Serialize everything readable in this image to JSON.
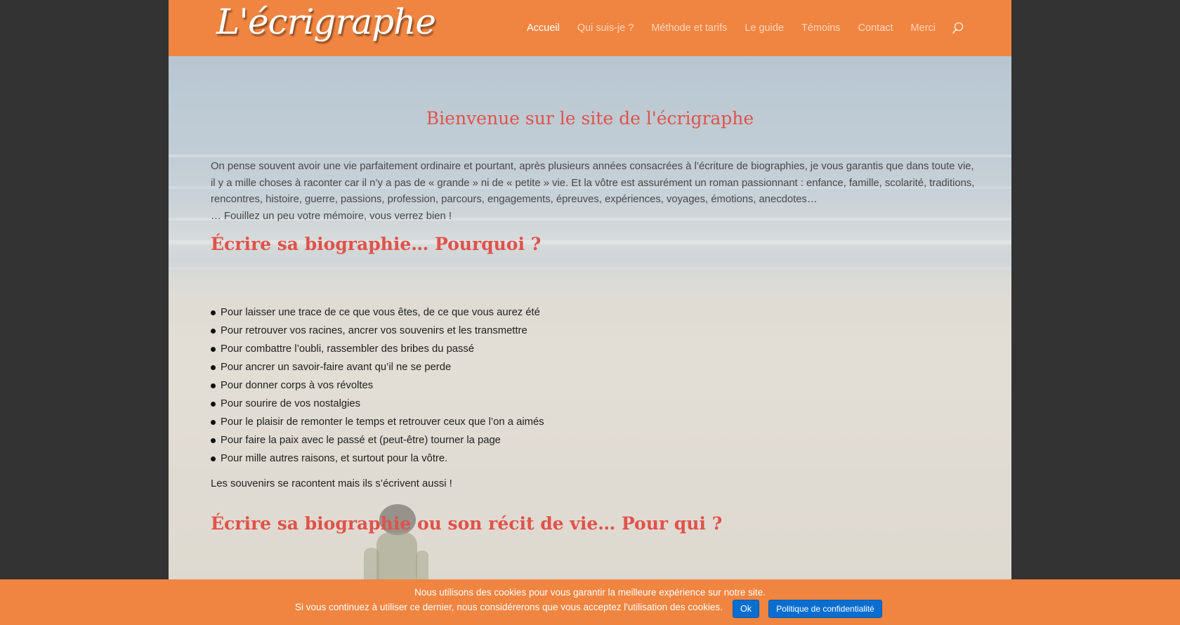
{
  "header": {
    "logo_text": "L'écrigraphe",
    "nav": [
      {
        "label": "Accueil",
        "active": true
      },
      {
        "label": "Qui suis-je ?",
        "active": false
      },
      {
        "label": "Méthode et tarifs",
        "active": false
      },
      {
        "label": "Le guide",
        "active": false
      },
      {
        "label": "Témoins",
        "active": false
      },
      {
        "label": "Contact",
        "active": false
      },
      {
        "label": "Merci",
        "active": false
      }
    ],
    "search_icon": "search-icon"
  },
  "main": {
    "title": "Bienvenue sur le site de l'écrigraphe",
    "intro": "On pense souvent avoir une vie parfaitement ordinaire et pourtant, après plusieurs années consacrées à l’écriture de biographies, je vous garantis que dans toute vie, il y a mille choses à raconter car il n’y a pas de « grande » ni de « petite » vie. Et la vôtre est assurément un roman passionnant : enfance, famille, scolarité, traditions, rencontres, histoire, guerre, passions, profession, parcours, engagements, épreuves, expériences, voyages, émotions, anecdotes…",
    "intro_line2": "… Fouillez un peu votre mémoire, vous verrez bien !",
    "section1_title": "Écrire sa biographie… Pourquoi ?",
    "bullets": [
      "Pour laisser une trace de ce que vous êtes, de ce que vous aurez été",
      "Pour retrouver vos racines, ancrer vos souvenirs et les transmettre",
      "Pour combattre l’oubli, rassembler des bribes du passé",
      "Pour ancrer un savoir-faire avant qu’il ne se perde",
      "Pour donner corps à vos révoltes",
      "Pour sourire de vos nostalgies",
      "Pour le plaisir de remonter le temps et retrouver ceux que l’on a aimés",
      "Pour faire la paix avec le passé et (peut-être) tourner la page",
      "Pour mille autres raisons, et surtout pour la vôtre."
    ],
    "closing": "Les souvenirs se racontent mais ils s’écrivent aussi !",
    "section2_title": "Écrire sa biographie ou son récit de vie… Pour qui ?"
  },
  "cookie_banner": {
    "line1": "Nous utilisons des cookies pour vous garantir la meilleure expérience sur notre site.",
    "line2": "Si vous continuez à utiliser ce dernier, nous considérerons que vous acceptez l'utilisation des cookies.",
    "ok_label": "Ok",
    "policy_label": "Politique de confidentialité"
  },
  "colors": {
    "header_bg": "#f08541",
    "heading": "#e0524a",
    "page_bg": "#333333",
    "button_blue": "#0a6ed1"
  }
}
